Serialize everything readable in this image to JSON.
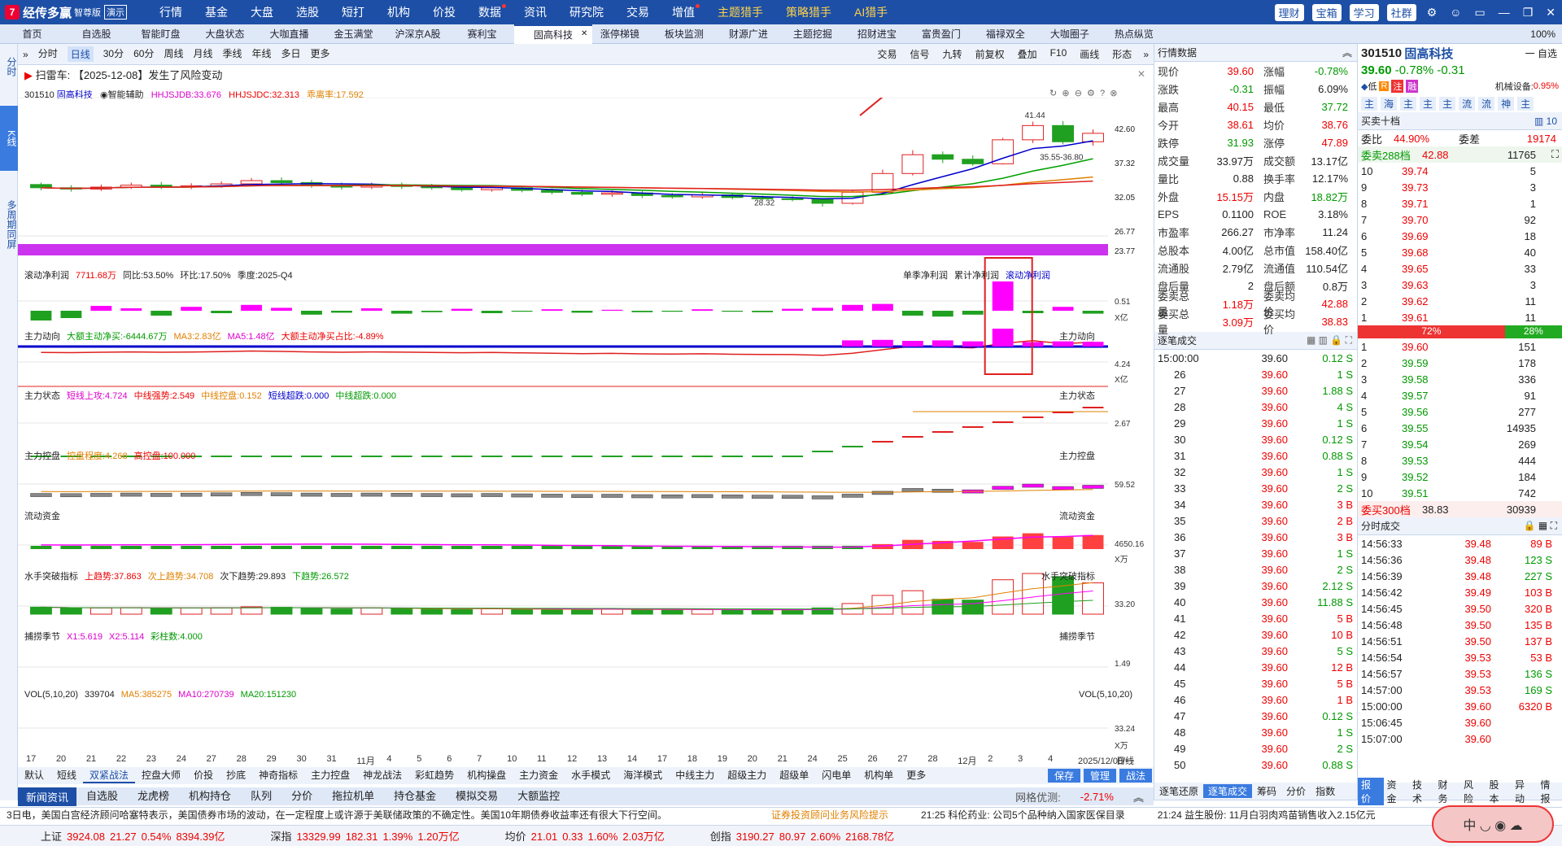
{
  "app": {
    "name": "经传多赢",
    "edition": "智尊版",
    "demo": "演示"
  },
  "menu": [
    "行情",
    "基金",
    "大盘",
    "选股",
    "短打",
    "机构",
    "价投",
    "数据",
    "资讯",
    "研究院",
    "交易",
    "增值",
    "主题猎手",
    "策略猎手",
    "AI猎手"
  ],
  "topRight": [
    "理财",
    "宝箱",
    "学习",
    "社群"
  ],
  "tabs": [
    "首页",
    "自选股",
    "智能盯盘",
    "大盘状态",
    "大咖直播",
    "金玉满堂",
    "沪深京A股",
    "赛利宝",
    "固高科技",
    "涨停梯镜",
    "板块监测",
    "财源广进",
    "主题挖掘",
    "招财进宝",
    "富贵盈门",
    "福禄双全",
    "大咖圈子",
    "热点纵览"
  ],
  "zoom": "100%",
  "leftSide": [
    "分时",
    "K线",
    "多周期同屏"
  ],
  "toolbar": [
    "分时",
    "日线",
    "30分",
    "60分",
    "周线",
    "月线",
    "季线",
    "年线",
    "多日",
    "更多"
  ],
  "toolbarRight": [
    "交易",
    "信号",
    "九转",
    "前复权",
    "叠加",
    "F10",
    "画线",
    "形态"
  ],
  "alert": {
    "prefix": "扫雷车:",
    "text": "【2025-12-08】发生了风险变动"
  },
  "stock": {
    "code": "301510",
    "name": "固高科技",
    "assist": "智能辅助"
  },
  "indicators": {
    "hh1": "HHJSJDB:33.676",
    "hh2": "HHJSJDC:32.313",
    "dev": "乖离率:17.592"
  },
  "chart_data": {
    "type": "candlestick",
    "title": "",
    "ylim": [
      23.77,
      42.6
    ],
    "ticks": [
      "42.60",
      "37.32",
      "32.05",
      "26.77",
      "23.77"
    ],
    "labels": [
      "41.44",
      "35.55-36.80",
      "28.32"
    ],
    "candles": [
      [
        31.7,
        31.2,
        32.0,
        30.8
      ],
      [
        31.2,
        31.0,
        31.6,
        30.6
      ],
      [
        31.0,
        31.3,
        31.7,
        30.7
      ],
      [
        31.3,
        31.6,
        32.0,
        31.0
      ],
      [
        31.6,
        31.3,
        32.1,
        31.0
      ],
      [
        31.3,
        31.5,
        31.9,
        31.0
      ],
      [
        31.5,
        31.8,
        32.2,
        31.2
      ],
      [
        31.8,
        32.3,
        32.7,
        31.5
      ],
      [
        32.3,
        32.0,
        32.8,
        31.6
      ],
      [
        32.0,
        31.6,
        32.4,
        31.2
      ],
      [
        31.6,
        31.3,
        32.0,
        30.9
      ],
      [
        31.3,
        31.6,
        32.0,
        31.0
      ],
      [
        31.6,
        31.4,
        32.0,
        31.0
      ],
      [
        31.4,
        31.2,
        31.8,
        30.9
      ],
      [
        31.2,
        30.9,
        31.5,
        30.6
      ],
      [
        30.9,
        31.2,
        31.6,
        30.6
      ],
      [
        31.2,
        30.8,
        31.5,
        30.5
      ],
      [
        30.8,
        30.5,
        31.1,
        30.2
      ],
      [
        30.5,
        30.2,
        30.9,
        29.9
      ],
      [
        30.2,
        30.4,
        30.8,
        29.8
      ],
      [
        30.4,
        30.0,
        30.7,
        29.6
      ],
      [
        30.0,
        29.8,
        30.4,
        29.5
      ],
      [
        29.8,
        30.1,
        30.4,
        29.5
      ],
      [
        30.1,
        29.7,
        30.4,
        29.4
      ],
      [
        29.7,
        29.5,
        30.0,
        29.2
      ],
      [
        29.5,
        29.4,
        29.9,
        29.1
      ],
      [
        29.4,
        28.8,
        29.6,
        28.3
      ],
      [
        28.8,
        30.5,
        30.9,
        28.6
      ],
      [
        30.5,
        33.4,
        34.0,
        30.3
      ],
      [
        33.4,
        36.3,
        37.0,
        33.1
      ],
      [
        36.3,
        35.6,
        36.8,
        35.0
      ],
      [
        35.6,
        34.9,
        36.2,
        34.6
      ],
      [
        34.9,
        38.6,
        38.9,
        34.8
      ],
      [
        38.6,
        40.8,
        41.4,
        38.1
      ],
      [
        40.8,
        38.3,
        41.5,
        37.9
      ],
      [
        38.3,
        39.6,
        40.2,
        37.7
      ]
    ],
    "volume": [
      45,
      38,
      40,
      42,
      36,
      39,
      41,
      47,
      44,
      37,
      33,
      40,
      36,
      32,
      30,
      34,
      31,
      29,
      28,
      33,
      30,
      27,
      29,
      28,
      26,
      25,
      40,
      68,
      120,
      150,
      95,
      90,
      220,
      260,
      240,
      200
    ],
    "mainForce": [
      -20,
      -15,
      10,
      5,
      -10,
      8,
      -5,
      12,
      6,
      -8,
      -4,
      5,
      -6,
      -3,
      4,
      -5,
      -2,
      3,
      -4,
      2,
      -3,
      -2,
      3,
      -2,
      -3,
      4,
      6,
      12,
      14,
      -10,
      -12,
      -8,
      60,
      -5,
      8,
      -6
    ]
  },
  "panels": {
    "p1": {
      "title": "滚动净利润",
      "v1": "7711.68万",
      "v2": "同比:53.50%",
      "v3": "环比:17.50%",
      "v4": "季度:2025-Q4",
      "r1": "单季净利润",
      "r2": "累计净利润",
      "r3": "滚动净利润",
      "ax1": "0.51",
      "ax2": "X亿"
    },
    "p2": {
      "title": "主力动向",
      "a": "大额主动净买:-6444.67万",
      "b": "MA3:2.83亿",
      "c": "MA5:1.48亿",
      "d": "大额主动净买占比:-4.89%",
      "ax1": "4.24",
      "ax2": "X亿"
    },
    "p3": {
      "title": "主力状态",
      "a": "短线上攻:4.724",
      "b": "中线强势:2.549",
      "c": "中线控盘:0.152",
      "d": "短线超跌:0.000",
      "e": "中线超跌:0.000",
      "ax1": "2.67"
    },
    "p4": {
      "title": "主力控盘",
      "a": "控盘程度:4.268",
      "b": "高控盘:100.000",
      "ax1": "59.52"
    },
    "p5": {
      "title": "流动资金",
      "ax1": "4650.16",
      "ax2": "X万"
    },
    "p6": {
      "title": "水手突破指标",
      "a": "上趋势:37.863",
      "b": "次上趋势:34.708",
      "c": "次下趋势:29.893",
      "d": "下趋势:26.572",
      "ax1": "33.20"
    },
    "p7": {
      "title": "捕捞季节",
      "a": "X1:5.619",
      "b": "X2:5.114",
      "c": "彩柱数:4.000",
      "ax1": "1.49"
    },
    "p8": {
      "title": "VOL(5,10,20)",
      "a": "339704",
      "b": "MA5:385275",
      "c": "MA10:270739",
      "d": "MA20:151230",
      "ax1": "33.24",
      "ax2": "X万"
    }
  },
  "dates": [
    "17",
    "20",
    "21",
    "22",
    "23",
    "24",
    "27",
    "28",
    "29",
    "30",
    "31",
    "11月",
    "4",
    "5",
    "6",
    "7",
    "10",
    "11",
    "12",
    "13",
    "14",
    "17",
    "18",
    "19",
    "20",
    "21",
    "24",
    "25",
    "26",
    "27",
    "28",
    "12月",
    "2",
    "3",
    "4",
    "2025/12/08/一"
  ],
  "dateRight": "日线",
  "bottomButtons": [
    "默认",
    "短线",
    "双紧战法",
    "控盘大师",
    "价投",
    "抄底",
    "神奇指标",
    "主力控盘",
    "神龙战法",
    "彩虹趋势",
    "机构操盘",
    "主力资金",
    "水手模式",
    "海洋模式",
    "中线主力",
    "超级主力",
    "超级单",
    "闪电单",
    "机构单",
    "更多"
  ],
  "bottomRight": [
    "保存",
    "管理",
    "战法"
  ],
  "newsTabs": [
    "新闻资讯",
    "自选股",
    "龙虎榜",
    "机构持仓",
    "队列",
    "分价",
    "拖拉机单",
    "持仓基金",
    "模拟交易",
    "大额监控"
  ],
  "gridOpt": "网格优测:",
  "gridVal": "-2.71%",
  "rpTabs": [
    "逐笔还原",
    "逐笔成交",
    "筹码",
    "分价",
    "指数"
  ],
  "rp2Tabs": [
    "报价",
    "资金",
    "技术",
    "财务",
    "风险",
    "股本",
    "异动",
    "情报"
  ],
  "ticker": {
    "a": "3日电，美国白宫经济顾问哈塞特表示，美国债券市场的波动，在一定程度上或许源于美联储政策的不确定性。美国10年期债券收益率还有很大下行空间。",
    "b": "证券投资顾问业务风险提示",
    "c": "21:25 科伦药业: 公司5个品种纳入国家医保目录",
    "d": "21:24 益生股份: 11月白羽肉鸡苗销售收入2.15亿元"
  },
  "indices": [
    {
      "n": "上证",
      "v": "3924.08",
      "c": "21.27",
      "p": "0.54%",
      "a": "8394.39亿"
    },
    {
      "n": "深指",
      "v": "13329.99",
      "c": "182.31",
      "p": "1.39%",
      "a": "1.20万亿"
    },
    {
      "n": "均价",
      "v": "21.01",
      "c": "0.33",
      "p": "1.60%",
      "a": "2.03万亿"
    },
    {
      "n": "创指",
      "v": "3190.27",
      "c": "80.97",
      "p": "2.60%",
      "a": "2168.78亿"
    }
  ],
  "quote": {
    "title": "行情数据",
    "rows": [
      [
        "现价",
        "39.60",
        "涨幅",
        "-0.78%"
      ],
      [
        "涨跌",
        "-0.31",
        "振幅",
        "6.09%"
      ],
      [
        "最高",
        "40.15",
        "最低",
        "37.72"
      ],
      [
        "今开",
        "38.61",
        "均价",
        "38.76"
      ],
      [
        "跌停",
        "31.93",
        "涨停",
        "47.89"
      ],
      [
        "成交量",
        "33.97万",
        "成交额",
        "13.17亿"
      ],
      [
        "量比",
        "0.88",
        "换手率",
        "12.17%"
      ],
      [
        "外盘",
        "15.15万",
        "内盘",
        "18.82万"
      ],
      [
        "EPS",
        "0.1100",
        "ROE",
        "3.18%"
      ],
      [
        "市盈率",
        "266.27",
        "市净率",
        "11.24"
      ],
      [
        "总股本",
        "4.00亿",
        "总市值",
        "158.40亿"
      ],
      [
        "流通股",
        "2.79亿",
        "流通值",
        "110.54亿"
      ],
      [
        "盘后量",
        "2",
        "盘后额",
        "0.8万"
      ],
      [
        "委卖总量",
        "1.18万",
        "委卖均价",
        "42.88"
      ],
      [
        "委买总量",
        "3.09万",
        "委买均价",
        "38.83"
      ]
    ]
  },
  "trades": {
    "title": "逐笔成交",
    "first": "15:00:00",
    "rows": [
      [
        "",
        "39.60",
        "0.12 S"
      ],
      [
        "26",
        "39.60",
        "1 S"
      ],
      [
        "27",
        "39.60",
        "1.88 S"
      ],
      [
        "28",
        "39.60",
        "4 S"
      ],
      [
        "29",
        "39.60",
        "1 S"
      ],
      [
        "30",
        "39.60",
        "0.12 S"
      ],
      [
        "31",
        "39.60",
        "0.88 S"
      ],
      [
        "32",
        "39.60",
        "1 S"
      ],
      [
        "33",
        "39.60",
        "2 S"
      ],
      [
        "34",
        "39.60",
        "3 B"
      ],
      [
        "35",
        "39.60",
        "2 B"
      ],
      [
        "36",
        "39.60",
        "3 B"
      ],
      [
        "37",
        "39.60",
        "1 S"
      ],
      [
        "38",
        "39.60",
        "2 S"
      ],
      [
        "39",
        "39.60",
        "2.12 S"
      ],
      [
        "40",
        "39.60",
        "11.88 S"
      ],
      [
        "41",
        "39.60",
        "5 B"
      ],
      [
        "42",
        "39.60",
        "10 B"
      ],
      [
        "43",
        "39.60",
        "5 S"
      ],
      [
        "44",
        "39.60",
        "12 B"
      ],
      [
        "45",
        "39.60",
        "5 B"
      ],
      [
        "46",
        "39.60",
        "1 B"
      ],
      [
        "47",
        "39.60",
        "0.12 S"
      ],
      [
        "48",
        "39.60",
        "1 S"
      ],
      [
        "49",
        "39.60",
        "2 S"
      ],
      [
        "50",
        "39.60",
        "0.88 S"
      ]
    ]
  },
  "rp2": {
    "code": "301510",
    "name": "固高科技",
    "self": "一 自选",
    "price": "39.60",
    "chg": "-0.78%",
    "chgv": "-0.31",
    "tag": "低",
    "industry": "机械设备:",
    "indChg": "0.95%",
    "book": "买卖十档",
    "wb": "委比",
    "wbv": "44.90%",
    "wc": "委差",
    "wcv": "19174",
    "sellTot": "委卖288档",
    "sellTotP": "42.88",
    "sellTotV": "11765",
    "sells": [
      [
        "10",
        "39.74",
        "5"
      ],
      [
        "9",
        "39.73",
        "3"
      ],
      [
        "8",
        "39.71",
        "1"
      ],
      [
        "7",
        "39.70",
        "92"
      ],
      [
        "6",
        "39.69",
        "18"
      ],
      [
        "5",
        "39.68",
        "40"
      ],
      [
        "4",
        "39.65",
        "33"
      ],
      [
        "3",
        "39.63",
        "3"
      ],
      [
        "2",
        "39.62",
        "11"
      ],
      [
        "1",
        "39.61",
        "11"
      ]
    ],
    "ratioS": "72%",
    "ratioB": "28%",
    "buys": [
      [
        "1",
        "39.60",
        "151"
      ],
      [
        "2",
        "39.59",
        "178"
      ],
      [
        "3",
        "39.58",
        "336"
      ],
      [
        "4",
        "39.57",
        "91"
      ],
      [
        "5",
        "39.56",
        "277"
      ],
      [
        "6",
        "39.55",
        "14935"
      ],
      [
        "7",
        "39.54",
        "269"
      ],
      [
        "8",
        "39.53",
        "444"
      ],
      [
        "9",
        "39.52",
        "184"
      ],
      [
        "10",
        "39.51",
        "742"
      ]
    ],
    "buyTot": "委买300档",
    "buyTotP": "38.83",
    "buyTotV": "30939",
    "tsTitle": "分时成交",
    "ts": [
      [
        "14:56:33",
        "39.48",
        "89 B"
      ],
      [
        "14:56:36",
        "39.48",
        "123 S"
      ],
      [
        "14:56:39",
        "39.48",
        "227 S"
      ],
      [
        "14:56:42",
        "39.49",
        "103 B"
      ],
      [
        "14:56:45",
        "39.50",
        "320 B"
      ],
      [
        "14:56:48",
        "39.50",
        "135 B"
      ],
      [
        "14:56:51",
        "39.50",
        "137 B"
      ],
      [
        "14:56:54",
        "39.53",
        "53 B"
      ],
      [
        "14:56:57",
        "39.53",
        "136 S"
      ],
      [
        "14:57:00",
        "39.53",
        "169 S"
      ],
      [
        "15:00:00",
        "39.60",
        "6320 B"
      ],
      [
        "15:06:45",
        "39.60",
        ""
      ],
      [
        "15:07:00",
        "39.60",
        ""
      ]
    ]
  }
}
